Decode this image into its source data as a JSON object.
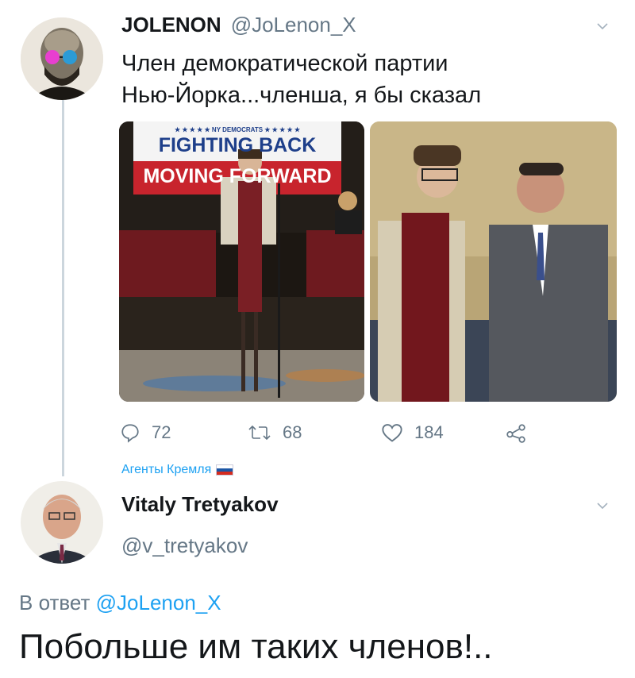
{
  "tweet": {
    "author_name": "JOLENON",
    "author_handle": "@JoLenon_X",
    "text_line1": "Член демократической партии",
    "text_line2": "Нью-Йорка...членша, я бы сказал",
    "photo1": {
      "banner_top": "★ ★ ★ ★ ★  NY DEMOCRATS  ★ ★ ★ ★ ★",
      "banner_line1": "FIGHTING BACK",
      "banner_line2": "MOVING FORWARD"
    },
    "actions": {
      "reply_count": "72",
      "retweet_count": "68",
      "like_count": "184"
    }
  },
  "social_context": {
    "label": "Агенты Кремля",
    "flag_colors": [
      "#ffffff",
      "#1c57a5",
      "#d52b1e"
    ]
  },
  "reply": {
    "author_name": "Vitaly Tretyakov",
    "author_handle": "@v_tretyakov",
    "replying_to_prefix": "В ответ",
    "replying_to_handle": "@JoLenon_X",
    "text": "Побольше им таких членов!.."
  },
  "colors": {
    "accent": "#1da1f2",
    "secondary_text": "#657786",
    "primary_text": "#14171a",
    "thread_line": "#ccd6dd"
  }
}
